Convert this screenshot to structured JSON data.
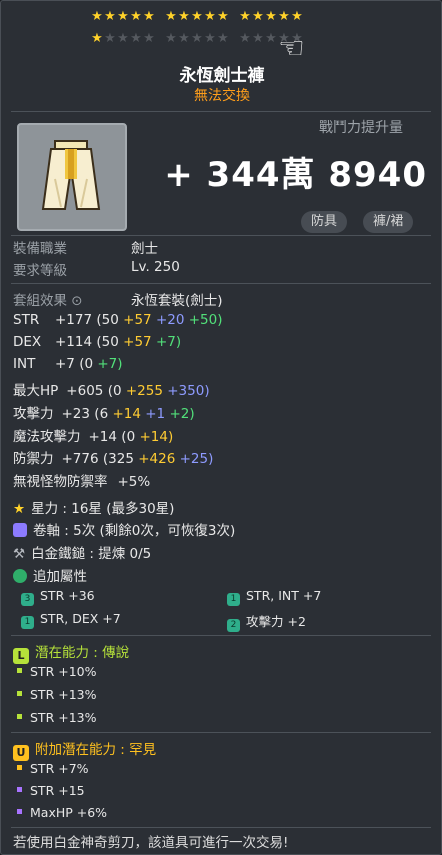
{
  "item": {
    "name": "永恆劍士褲",
    "trade_status": "無法交換"
  },
  "stars": {
    "filled": 16,
    "total": 30
  },
  "combat_power": {
    "label": "戰鬥力提升量",
    "value": "+ 344萬 8940"
  },
  "badges": [
    "防具",
    "褲/裙"
  ],
  "requirements": [
    {
      "label": "裝備職業",
      "value": "劍士"
    },
    {
      "label": "要求等級",
      "value": "Lv. 250"
    }
  ],
  "set_effect": {
    "label": "套組效果",
    "value": "永恆套裝(劍士)"
  },
  "stats": {
    "str": {
      "name": "STR",
      "total": "+177",
      "base": "(50",
      "a": "+57",
      "b": "+20",
      "c": "+50)"
    },
    "dex": {
      "name": "DEX",
      "total": "+114",
      "base": "(50",
      "a": "+57",
      "b": "+7)"
    },
    "int": {
      "name": "INT",
      "total": "+7",
      "base": "(0",
      "a": "+7)"
    },
    "hp": {
      "name": "最大HP",
      "total": "+605",
      "base": "(0",
      "a": "+255",
      "b": "+350)"
    },
    "atk": {
      "name": "攻擊力",
      "total": "+23",
      "base": "(6",
      "a": "+14",
      "b": "+1",
      "c": "+2)"
    },
    "matk": {
      "name": "魔法攻擊力",
      "total": "+14",
      "base": "(0",
      "a": "+14)"
    },
    "def": {
      "name": "防禦力",
      "total": "+776",
      "base": "(325",
      "a": "+426",
      "b": "+25)"
    },
    "ignore": {
      "name": "無視怪物防禦率",
      "total": "+5%"
    }
  },
  "star_force": "星力 : 16星 (最多30星)",
  "scroll": "卷軸 : 5次 (剩餘0次，可恢復3次)",
  "hammer": "白金鐵鎚 : 提煉 0/5",
  "bonus": {
    "label": "追加屬性",
    "items": [
      {
        "icon": "3",
        "text": "STR  +36"
      },
      {
        "icon": "1",
        "text": "STR, INT  +7"
      },
      {
        "icon": "1",
        "text": "STR, DEX  +7"
      },
      {
        "icon": "2",
        "text": "攻擊力 +2"
      }
    ]
  },
  "potential": {
    "icon": "L",
    "label": "潛在能力",
    "grade": "傳說",
    "lines": [
      "STR +10%",
      "STR +13%",
      "STR +13%"
    ]
  },
  "additional_potential": {
    "icon": "U",
    "label": "附加潛在能力",
    "grade": "罕見",
    "lines": [
      "STR +7%",
      "STR +15",
      "MaxHP +6%"
    ]
  },
  "footer": "若使用白金神奇剪刀，該道具可進行一次交易!",
  "colors": {
    "gold": "#ffd22a",
    "orange": "#ff9e1b",
    "potential_green": "#b6e23a",
    "bonus_purple": "#a873ff"
  }
}
